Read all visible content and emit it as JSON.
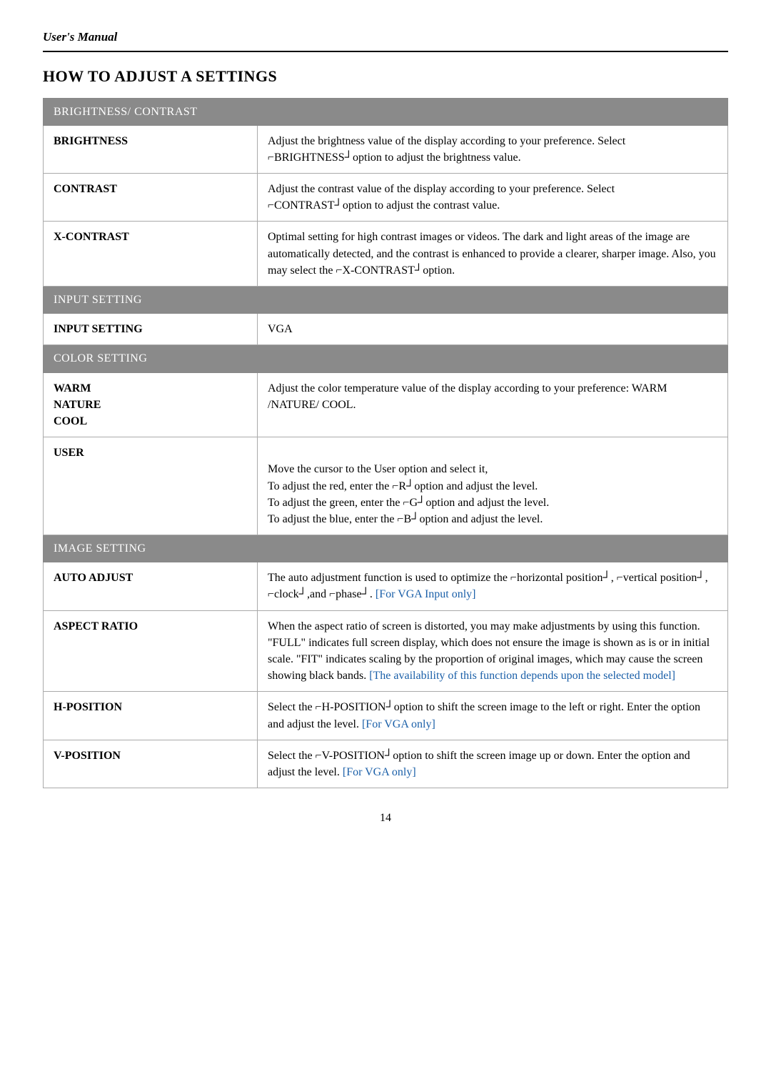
{
  "header": {
    "manual_label": "User's Manual",
    "title": "HOW TO ADJUST A SETTINGS"
  },
  "page_number": "14",
  "sections": [
    {
      "header": "BRIGHTNESS/ CONTRAST",
      "rows": [
        {
          "label": "BRIGHTNESS",
          "description": "Adjust the brightness value of the display according to your preference. Select ⌐BRIGHTNESS┘option to adjust the brightness value.",
          "link": null
        },
        {
          "label": "CONTRAST",
          "description": "Adjust the contrast value of the display according to your preference. Select ⌐CONTRAST┘option to adjust the contrast value.",
          "link": null
        },
        {
          "label": "X-CONTRAST",
          "description": "Optimal setting for high contrast images or videos. The dark and light areas of the image are automatically detected, and the contrast is enhanced to provide a clearer, sharper image. Also, you may select the ⌐X-CONTRAST┘option.",
          "link": null
        }
      ]
    },
    {
      "header": "INPUT SETTING",
      "rows": [
        {
          "label": "INPUT SETTING",
          "description": "VGA",
          "link": null
        }
      ]
    },
    {
      "header": "COLOR SETTING",
      "rows": [
        {
          "label": "WARM\nNATURE\nCOOL",
          "description": "Adjust the color temperature value of the display according to your preference: WARM /NATURE/ COOL.",
          "link": null
        },
        {
          "label": "USER",
          "description": "Move the cursor to the User option and select it,\nTo adjust the red, enter the ⌐R┘option and adjust the level.\nTo adjust the green, enter the ⌐G┘option and adjust the level.\nTo adjust the blue, enter the ⌐B┘option and adjust the level.",
          "link": null
        }
      ]
    },
    {
      "header": "IMAGE SETTING",
      "rows": [
        {
          "label": "AUTO ADJUST",
          "description_before": "The auto adjustment function is used to optimize the ⌐horizontal position┘, ⌐vertical position┘, ⌐clock┘,and ⌐phase┘. ",
          "description_link": "[For VGA Input only]",
          "description_after": "",
          "link": true
        },
        {
          "label": "ASPECT RATIO",
          "description_before": "When the aspect ratio of screen is distorted, you may make adjustments by using this function. \"FULL\" indicates full screen display, which does not ensure the image is shown as is or in initial scale. \"FIT\" indicates scaling by the proportion of original images, which may cause the screen showing black bands. ",
          "description_link": "[The availability of this function depends upon the selected model]",
          "description_after": "",
          "link": true
        },
        {
          "label": "H-POSITION",
          "description_before": "Select the ⌐H-POSITION┘option to shift the screen image to the left or right. Enter the option and adjust the level. ",
          "description_link": "[For VGA only]",
          "description_after": "",
          "link": true
        },
        {
          "label": "V-POSITION",
          "description_before": "Select the ⌐V-POSITION┘option to shift the screen image up or down. Enter the option and adjust the level. ",
          "description_link": "[For VGA only]",
          "description_after": "",
          "link": true
        }
      ]
    }
  ]
}
